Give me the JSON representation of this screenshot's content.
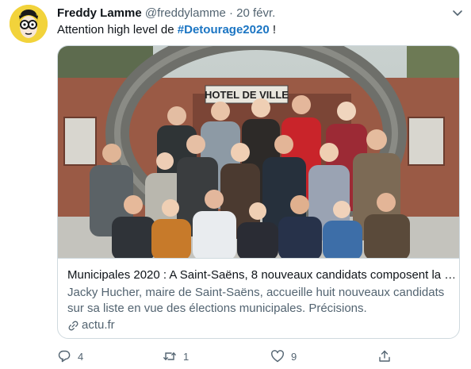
{
  "author": {
    "name": "Freddy Lamme",
    "handle": "@freddylamme",
    "separator": "·",
    "date": "20 févr."
  },
  "tweet": {
    "text_before": "Attention high level de ",
    "hashtag": "#Detourage2020",
    "text_after": " !"
  },
  "card": {
    "image_sign": "HOTEL DE VILLE",
    "title": "Municipales 2020 : A Saint-Saëns, 8 nouveaux candidats composent la …",
    "description": "Jacky Hucher, maire de Saint-Saëns, accueille huit nouveaux candidats sur sa liste en vue des élections municipales. Précisions.",
    "domain": "actu.fr"
  },
  "actions": {
    "reply_count": "4",
    "retweet_count": "1",
    "like_count": "9"
  },
  "colors": {
    "hashtag": "#1b75c3",
    "secondary_text": "#536471",
    "border": "#cfd9de",
    "avatar_bg": "#f2d33b"
  },
  "icons": [
    "caret-down-icon",
    "link-icon",
    "reply-icon",
    "retweet-icon",
    "like-icon",
    "share-icon"
  ]
}
